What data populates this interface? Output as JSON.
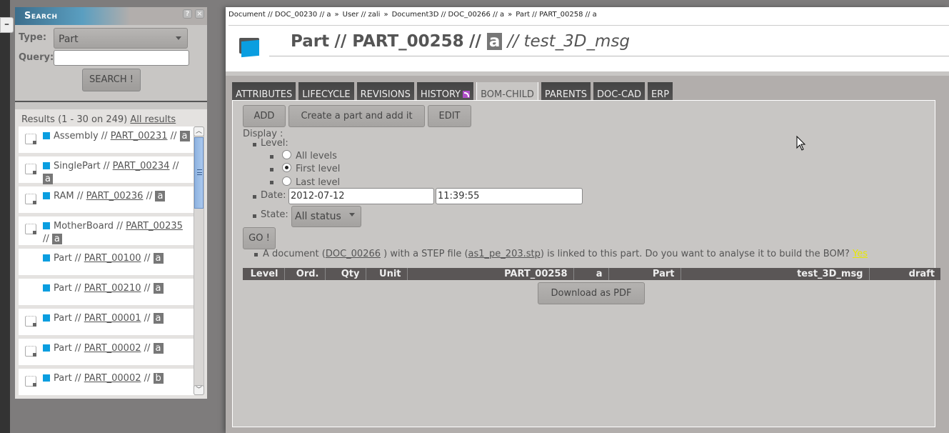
{
  "sidebar_toggle": {
    "label": "–"
  },
  "search": {
    "title": "Search",
    "help_label": "?",
    "close_label": "×",
    "type_label": "Type:",
    "type_value": "Part",
    "query_label": "Query:",
    "query_value": "",
    "query_placeholder": "",
    "button_label": "SEARCH !",
    "results_summary": "Results (1 - 30 on 249)",
    "all_results_label": "All results",
    "results": [
      {
        "type": "Assembly",
        "ref": "PART_00231",
        "rev": "a",
        "has_doc_icon": true
      },
      {
        "type": "SinglePart",
        "ref": "PART_00234",
        "rev": "a",
        "has_doc_icon": true
      },
      {
        "type": "RAM",
        "ref": "PART_00236",
        "rev": "a",
        "has_doc_icon": true
      },
      {
        "type": "MotherBoard",
        "ref": "PART_00235",
        "rev": "a",
        "has_doc_icon": true
      },
      {
        "type": "Part",
        "ref": "PART_00100",
        "rev": "a",
        "has_doc_icon": false
      },
      {
        "type": "Part",
        "ref": "PART_00210",
        "rev": "a",
        "has_doc_icon": false
      },
      {
        "type": "Part",
        "ref": "PART_00001",
        "rev": "a",
        "has_doc_icon": true
      },
      {
        "type": "Part",
        "ref": "PART_00002",
        "rev": "a",
        "has_doc_icon": true
      },
      {
        "type": "Part",
        "ref": "PART_00002",
        "rev": "b",
        "has_doc_icon": true
      }
    ],
    "separator": "//"
  },
  "breadcrumb": [
    "Document // DOC_00230 // a",
    "User // zali",
    "Document3D // DOC_00266 // a",
    "Part // PART_00258 // a"
  ],
  "breadcrumb_sep": "»",
  "header": {
    "type": "Part",
    "reference": "PART_00258",
    "revision": "a",
    "name": "test_3D_msg",
    "sep": "//"
  },
  "tabs": [
    {
      "label": "ATTRIBUTES",
      "active": false
    },
    {
      "label": "LIFECYCLE",
      "active": false
    },
    {
      "label": "REVISIONS",
      "active": false
    },
    {
      "label": "HISTORY",
      "active": false,
      "rss": true
    },
    {
      "label": "BOM-CHILD",
      "active": true
    },
    {
      "label": "PARENTS",
      "active": false
    },
    {
      "label": "DOC-CAD",
      "active": false
    },
    {
      "label": "ERP",
      "active": false
    }
  ],
  "bom": {
    "add_label": "ADD",
    "create_label": "Create a part and add it",
    "edit_label": "EDIT",
    "display_label": "Display :",
    "level_label": "Level:",
    "level_options": [
      "All levels",
      "First level",
      "Last level"
    ],
    "level_selected": "First level",
    "date_label": "Date:",
    "date_value": "2012-07-12",
    "time_value": "11:39:55",
    "state_label": "State:",
    "state_value": "All status",
    "go_label": "GO !",
    "step_msg_prefix": "A document (",
    "step_doc_link": "DOC_00266",
    "step_msg_mid": " ) with a STEP file (",
    "step_file_link": "as1_pe_203.stp",
    "step_msg_suffix": ") is linked to this part. Do you want to analyse it to build the BOM?",
    "step_yes": "Yes",
    "table_headers": [
      "Level",
      "Ord.",
      "Qty",
      "Unit",
      "PART_00258",
      "a",
      "Part",
      "test_3D_msg",
      "draft"
    ],
    "pdf_label": "Download as PDF"
  },
  "colors": {
    "accent_blue": "#0a9ee0",
    "tab_dark": "#4e4c4c",
    "table_header": "#5a5656",
    "yes_link": "#e8e800"
  }
}
